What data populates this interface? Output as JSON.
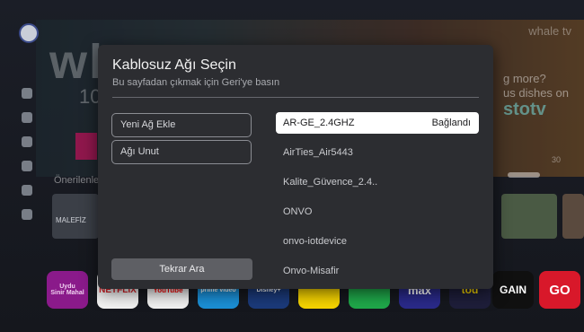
{
  "background": {
    "brand": "whale tv",
    "hero_big": "wh",
    "hero_number": "10",
    "hero_right_lines": [
      "g more?",
      "us dishes on"
    ],
    "hero_right_logo": "stotv",
    "hero_badge": "30",
    "recommended_label": "Önerilenler",
    "thumb_label": "MALEFİZ",
    "apps": [
      {
        "name": "Uydu",
        "sub": "Sinir Mahal"
      },
      {
        "name": "NETFLIX"
      },
      {
        "name": "YouTube"
      },
      {
        "name": "prime video"
      },
      {
        "name": "Disney+"
      },
      {
        "name": ""
      },
      {
        "name": ""
      },
      {
        "name": "max"
      },
      {
        "name": "tod"
      },
      {
        "name": "GAIN"
      },
      {
        "name": "GO"
      }
    ]
  },
  "dialog": {
    "title": "Kablosuz Ağı Seçin",
    "subtitle": "Bu sayfadan çıkmak için Geri'ye basın",
    "add_network": "Yeni Ağ Ekle",
    "forget_network": "Ağı Unut",
    "rescan": "Tekrar Ara",
    "networks": [
      {
        "ssid": "AR-GE_2.4GHZ",
        "status": "Bağlandı",
        "selected": true
      },
      {
        "ssid": "AirTies_Air5443",
        "status": ""
      },
      {
        "ssid": "Kalite_Güvence_2.4..",
        "status": ""
      },
      {
        "ssid": "ONVO",
        "status": ""
      },
      {
        "ssid": "onvo-iotdevice",
        "status": ""
      },
      {
        "ssid": "Onvo-Misafir",
        "status": ""
      }
    ]
  },
  "colors": {
    "dialog_bg": "#2c2d31",
    "selected_bg": "#ffffff",
    "rescan_bg": "#5e5f64"
  }
}
